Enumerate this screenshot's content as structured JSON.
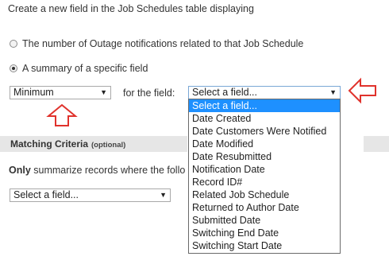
{
  "intro_text": "Create a new field in the Job Schedules table displaying",
  "options": {
    "outage": "The number of Outage notifications related to that Job Schedule",
    "summary": "A summary of a specific field"
  },
  "aggregate_select": {
    "value": "Minimum"
  },
  "for_the_field_label": "for the field:",
  "field_select": {
    "value": "Select a field...",
    "items": [
      "Select a field...",
      "Date Created",
      "Date Customers Were Notified",
      "Date Modified",
      "Date Resubmitted",
      "Notification Date",
      "Record ID#",
      "Related Job Schedule",
      "Returned to Author Date",
      "Submitted Date",
      "Switching End Date",
      "Switching Start Date"
    ]
  },
  "matching": {
    "title": "Matching Criteria",
    "optional": "(optional)",
    "only_bold": "Only",
    "only_rest": " summarize records where the follo"
  },
  "criteria_select": {
    "value": "Select a field..."
  },
  "annotation_color": "#e0322c",
  "highlight_color": "#1e90ff"
}
